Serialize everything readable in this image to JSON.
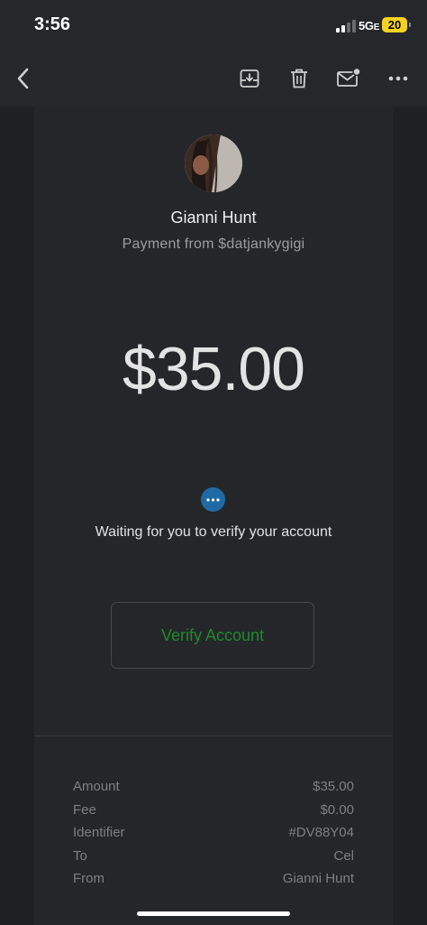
{
  "status_bar": {
    "time": "3:56",
    "network": "5G",
    "network_suffix": "E",
    "battery": "20"
  },
  "toolbar": {
    "icons": [
      "back-icon",
      "archive-icon",
      "trash-icon",
      "mail-unread-icon",
      "more-icon"
    ]
  },
  "payment": {
    "payer_name": "Gianni Hunt",
    "subtitle": "Payment from $datjankygigi",
    "amount": "$35.00",
    "status_text": "Waiting for you to verify your account",
    "verify_label": "Verify Account"
  },
  "details": [
    {
      "label": "Amount",
      "value": "$35.00"
    },
    {
      "label": "Fee",
      "value": "$0.00"
    },
    {
      "label": "Identifier",
      "value": "#DV88Y04"
    },
    {
      "label": "To",
      "value": "Cel"
    },
    {
      "label": "From",
      "value": "Gianni Hunt"
    }
  ],
  "colors": {
    "accent_green": "#1f8a2d",
    "status_blue": "#1f6aa5",
    "battery_yellow": "#f4d21f"
  }
}
